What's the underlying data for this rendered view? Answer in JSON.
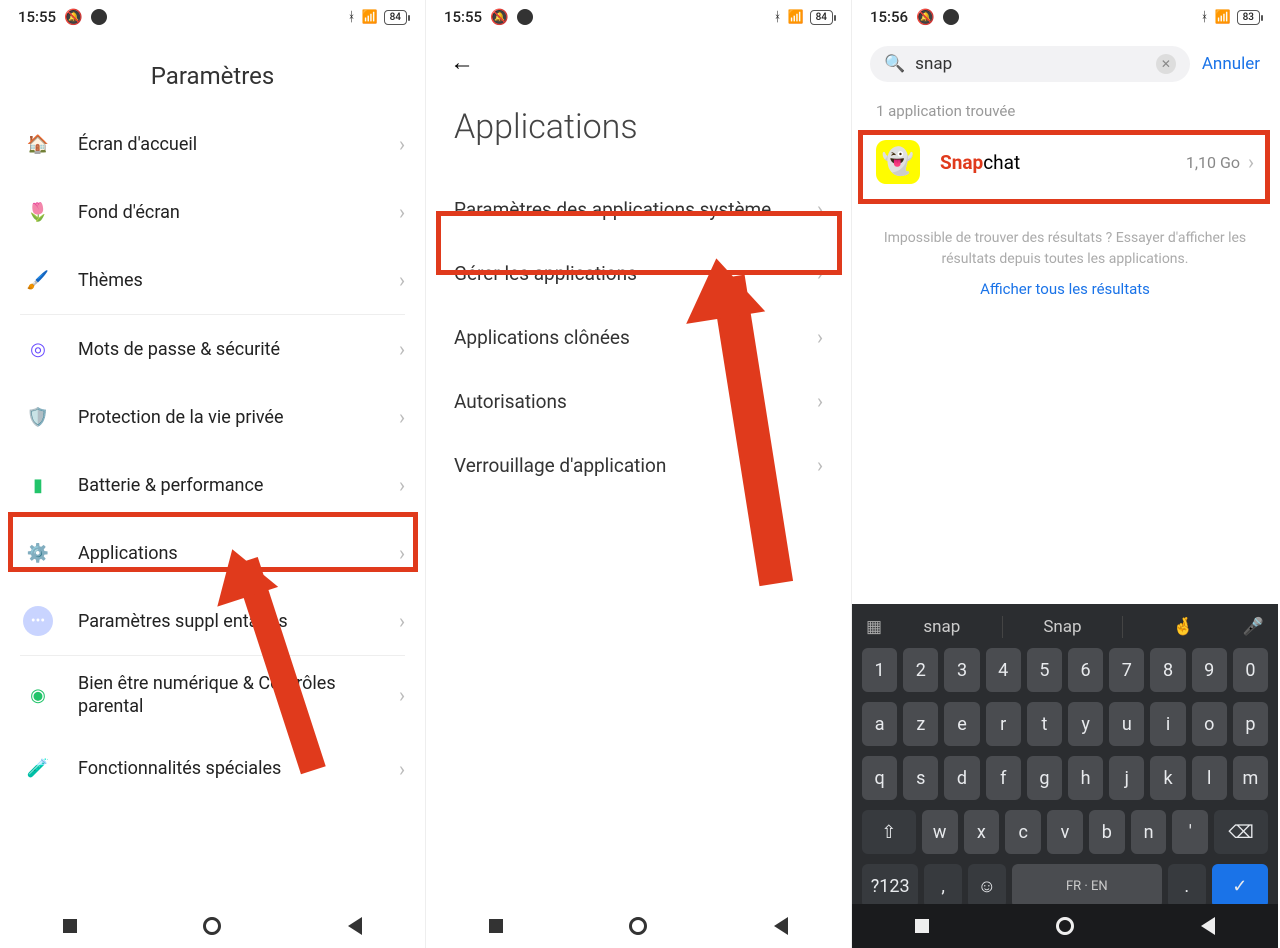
{
  "screen1": {
    "status": {
      "time": "15:55",
      "battery": "84"
    },
    "title": "Paramètres",
    "items": [
      {
        "label": "Écran d'accueil",
        "icon": "home",
        "cls": "ic-home"
      },
      {
        "label": "Fond d'écran",
        "icon": "wallpaper",
        "cls": "ic-wall"
      },
      {
        "label": "Thèmes",
        "icon": "themes",
        "cls": "ic-theme"
      },
      {
        "label": "Mots de passe & sécurité",
        "icon": "fingerprint",
        "cls": "ic-pwd"
      },
      {
        "label": "Protection de la vie privée",
        "icon": "shield",
        "cls": "ic-shield"
      },
      {
        "label": "Batterie & performance",
        "icon": "battery",
        "cls": "ic-batt"
      },
      {
        "label": "Applications",
        "icon": "apps",
        "cls": "ic-apps",
        "highlight": true
      },
      {
        "label": "Paramètres suppl    entaires",
        "icon": "more",
        "cls": "ic-more"
      },
      {
        "label": "Bien être numérique & Contrôles parental",
        "icon": "wellbeing",
        "cls": "ic-well"
      },
      {
        "label": "Fonctionnalités spéciales",
        "icon": "features",
        "cls": "ic-feat"
      }
    ]
  },
  "screen2": {
    "status": {
      "time": "15:55",
      "battery": "84"
    },
    "title": "Applications",
    "items": [
      {
        "label": "Paramètres des applications système"
      },
      {
        "label": "Gérer les applications",
        "highlight": true
      },
      {
        "label": "Applications clônées"
      },
      {
        "label": "Autorisations"
      },
      {
        "label": "Verrouillage d'application"
      }
    ]
  },
  "screen3": {
    "status": {
      "time": "15:56",
      "battery": "83"
    },
    "search": {
      "value": "snap",
      "cancel": "Annuler"
    },
    "result_count": "1 application trouvée",
    "result": {
      "name_match": "Snap",
      "name_rest": "chat",
      "size": "1,10 Go"
    },
    "no_results": "Impossible de trouver des résultats ? Essayer d'afficher les résultats depuis toutes les applications.",
    "show_all": "Afficher tous les résultats",
    "keyboard": {
      "suggestions": [
        "snap",
        "Snap",
        "🤞"
      ],
      "row_num": [
        "1",
        "2",
        "3",
        "4",
        "5",
        "6",
        "7",
        "8",
        "9",
        "0"
      ],
      "row1": [
        "a",
        "z",
        "e",
        "r",
        "t",
        "y",
        "u",
        "i",
        "o",
        "p"
      ],
      "row2": [
        "q",
        "s",
        "d",
        "f",
        "g",
        "h",
        "j",
        "k",
        "l",
        "m"
      ],
      "row3": [
        "⇧",
        "w",
        "x",
        "c",
        "v",
        "b",
        "n",
        "'",
        "⌫"
      ],
      "row4": [
        "?123",
        ",",
        "☺",
        "FR · EN",
        ".",
        "✓"
      ]
    }
  }
}
